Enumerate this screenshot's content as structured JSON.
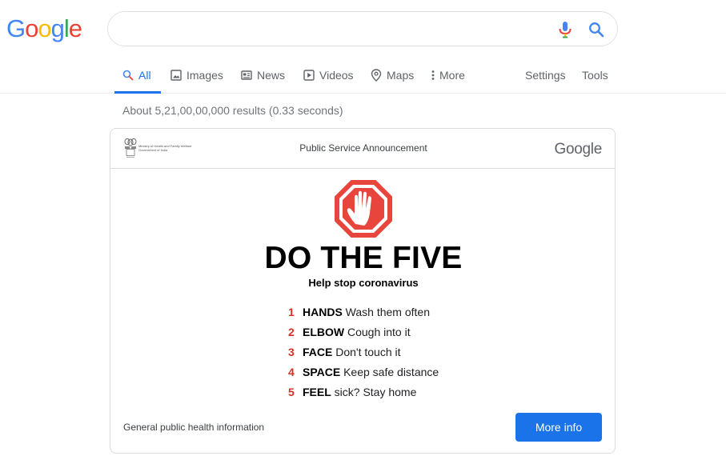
{
  "logo": {
    "letters": [
      {
        "char": "G",
        "color": "#4285F4"
      },
      {
        "char": "o",
        "color": "#EA4335"
      },
      {
        "char": "o",
        "color": "#FBBC05"
      },
      {
        "char": "g",
        "color": "#4285F4"
      },
      {
        "char": "l",
        "color": "#34A853"
      },
      {
        "char": "e",
        "color": "#EA4335"
      }
    ]
  },
  "search": {
    "value": "",
    "mic_icon": "mic-icon",
    "search_icon": "search-icon"
  },
  "tabs": [
    {
      "label": "All",
      "icon": "search-icon",
      "active": true
    },
    {
      "label": "Images",
      "icon": "image-icon"
    },
    {
      "label": "News",
      "icon": "newspaper-icon"
    },
    {
      "label": "Videos",
      "icon": "play-icon"
    },
    {
      "label": "Maps",
      "icon": "map-pin-icon"
    },
    {
      "label": "More",
      "icon": "more-vert-icon"
    }
  ],
  "tools": {
    "settings": "Settings",
    "tools": "Tools"
  },
  "results_stats": "About 5,21,00,00,000 results (0.33 seconds)",
  "card": {
    "ministry_line1": "Ministry of Health and Family Welfare",
    "ministry_line2": "Government of India",
    "header_title": "Public Service Announcement",
    "logo_text": "Google",
    "headline": "DO THE FIVE",
    "subhead": "Help stop coronavirus",
    "steps": [
      {
        "num": "1",
        "keyword": "HANDS",
        "text": "Wash them often"
      },
      {
        "num": "2",
        "keyword": "ELBOW",
        "text": "Cough into it"
      },
      {
        "num": "3",
        "keyword": "FACE",
        "text": "Don't touch it"
      },
      {
        "num": "4",
        "keyword": "SPACE",
        "text": "Keep safe distance"
      },
      {
        "num": "5",
        "keyword": "FEEL",
        "text": "sick? Stay home"
      }
    ],
    "footer_text": "General public health information",
    "button_label": "More info"
  },
  "colors": {
    "accent": "#1a73e8",
    "stop_red": "#e8453c",
    "number_red": "#d93025"
  }
}
